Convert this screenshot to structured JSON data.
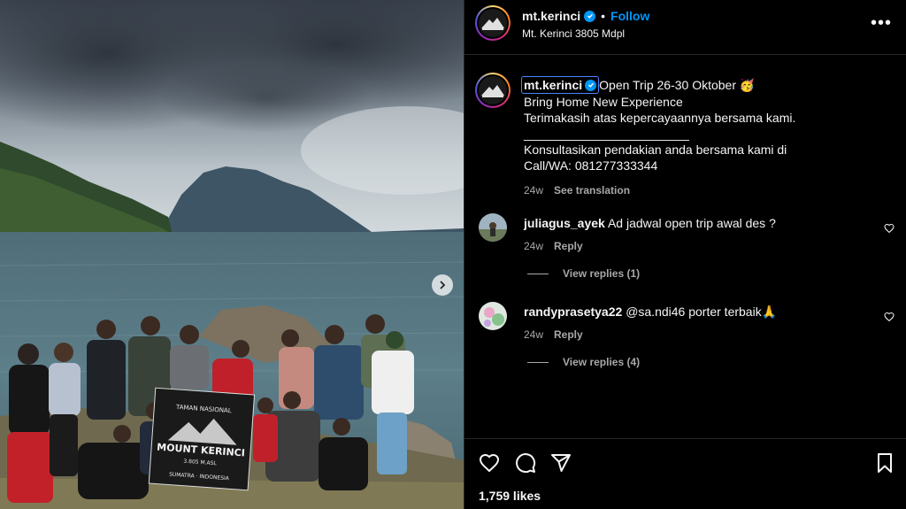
{
  "post": {
    "account": "mt.kerinci",
    "follow_label": "Follow",
    "separator": "•",
    "location": "Mt. Kerinci 3805 Mdpl",
    "more_label": "•••"
  },
  "caption": {
    "username": "mt.kerinci",
    "line1": "Open Trip 26-30 Oktober 🥳",
    "line2": "Bring Home New Experience",
    "line3": "Terimakasih atas kepercayaannya bersama kami.",
    "separator_line": "________________________",
    "line4": "Konsultasikan pendakian anda bersama kami di",
    "line5": "Call/WA: 081277333344",
    "time": "24w",
    "see_translation": "See translation"
  },
  "comments": [
    {
      "username": "juliagus_ayek",
      "text": "Ad jadwal open trip awal des ?",
      "time": "24w",
      "reply_label": "Reply",
      "view_replies": "View replies (1)"
    },
    {
      "username": "randyprasetya22",
      "text": "@sa.ndi46 porter terbaik🙏",
      "time": "24w",
      "reply_label": "Reply",
      "view_replies": "View replies (4)"
    }
  ],
  "footer": {
    "likes": "1,759 likes",
    "icons": [
      "heart-icon",
      "comment-icon",
      "share-icon",
      "bookmark-icon"
    ]
  },
  "banner": {
    "line1": "TAMAN NASIONAL",
    "line2": "MOUNT KERINCI",
    "line3": "3.805 M.ASL",
    "line4": "SUMATRA · INDONESIA"
  },
  "colors": {
    "accent": "#0095f6",
    "panel_bg": "#000000",
    "muted_text": "#a8a8a8"
  }
}
